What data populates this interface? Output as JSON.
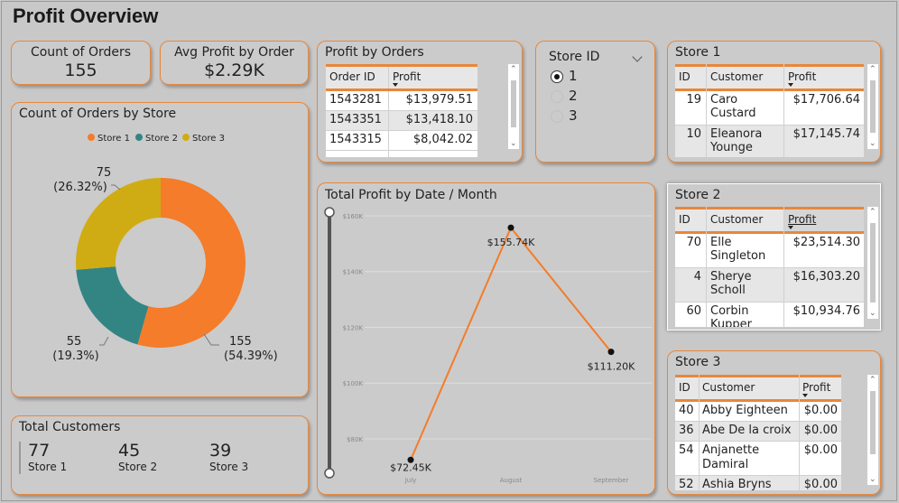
{
  "page": {
    "title": "Profit Overview"
  },
  "kpi": {
    "orders_label": "Count of Orders",
    "orders_value": "155",
    "avg_label": "Avg Profit by Order",
    "avg_value": "$2.29K"
  },
  "donut": {
    "title": "Count of Orders by Store",
    "legend": [
      "Store 1",
      "Store 2",
      "Store 3"
    ],
    "labels": [
      {
        "count": "155",
        "pct": "(54.39%)"
      },
      {
        "count": "55",
        "pct": "(19.3%)"
      },
      {
        "count": "75",
        "pct": "(26.32%)"
      }
    ]
  },
  "customers": {
    "title": "Total Customers",
    "items": [
      {
        "value": "77",
        "label": "Store 1"
      },
      {
        "value": "45",
        "label": "Store 2"
      },
      {
        "value": "39",
        "label": "Store 3"
      }
    ]
  },
  "profit_orders": {
    "title": "Profit by Orders",
    "headers": [
      "Order ID",
      "Profit"
    ],
    "rows": [
      [
        "1543281",
        "$13,979.51"
      ],
      [
        "1543351",
        "$13,418.10"
      ],
      [
        "1543315",
        "$8,042.02"
      ]
    ]
  },
  "slicer": {
    "title": "Store ID",
    "options": [
      "1",
      "2",
      "3"
    ],
    "selected": "1"
  },
  "store1": {
    "title": "Store 1",
    "headers": [
      "ID",
      "Customer",
      "Profit"
    ],
    "rows": [
      [
        "19",
        "Caro",
        "Custard",
        "$17,706.64"
      ],
      [
        "10",
        "Eleanora",
        "Younge",
        "$17,145.74"
      ]
    ]
  },
  "store2": {
    "title": "Store 2",
    "headers": [
      "ID",
      "Customer",
      "Profit"
    ],
    "rows": [
      [
        "70",
        "Elle",
        "Singleton",
        "$23,514.30"
      ],
      [
        "4",
        "Sherye",
        "Scholl",
        "$16,303.20"
      ],
      [
        "60",
        "Corbin",
        "Kupper",
        "$10,934.76"
      ]
    ]
  },
  "store3": {
    "title": "Store 3",
    "headers": [
      "ID",
      "Customer",
      "Profit"
    ],
    "rows": [
      [
        "40",
        "Abby Eighteen",
        "",
        "$0.00"
      ],
      [
        "36",
        "Abe De la croix",
        "",
        "$0.00"
      ],
      [
        "54",
        "Anjanette",
        "Damiral",
        "$0.00"
      ],
      [
        "52",
        "Ashia Bryns",
        "",
        "$0.00"
      ]
    ]
  },
  "chart_data": [
    {
      "type": "pie",
      "title": "Count of Orders by Store",
      "categories": [
        "Store 1",
        "Store 2",
        "Store 3"
      ],
      "values": [
        155,
        55,
        75
      ],
      "colors": [
        "#f47c2a",
        "#338584",
        "#d0ac14"
      ],
      "legend": "top"
    },
    {
      "type": "line",
      "title": "Total Profit by Date / Month",
      "categories": [
        "July",
        "August",
        "September"
      ],
      "values": [
        72450,
        155740,
        111200
      ],
      "data_labels": [
        "$72.45K",
        "$155.74K",
        "$111.20K"
      ],
      "y_ticks": [
        "$80K",
        "$100K",
        "$120K",
        "$140K",
        "$160K"
      ],
      "ylim": [
        68000,
        160000
      ],
      "color": "#f47c2a",
      "grid": true
    }
  ]
}
